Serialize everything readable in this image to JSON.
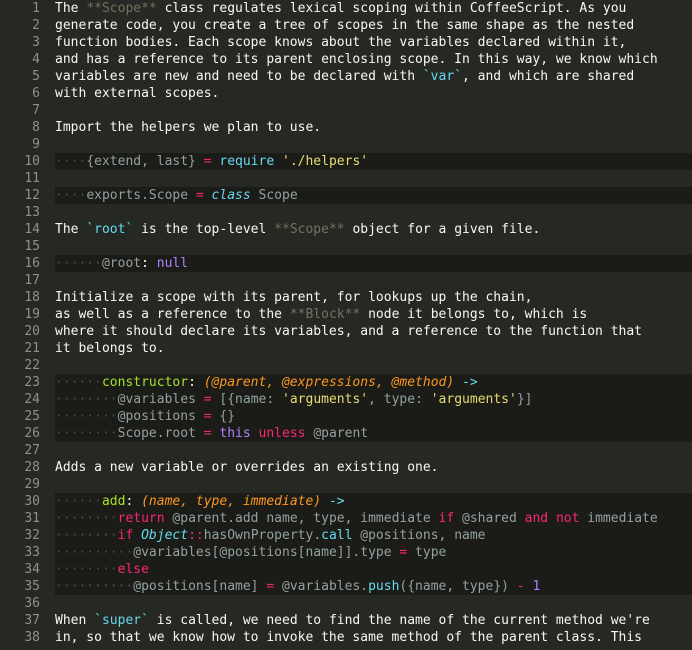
{
  "editor": {
    "lines": [
      {
        "n": "1",
        "code": false,
        "segs": [
          [
            "The ",
            "t-plain"
          ],
          [
            "**Scope**",
            "t-c"
          ],
          [
            " class regulates lexical scoping within CoffeeScript. As you",
            "t-plain"
          ]
        ]
      },
      {
        "n": "2",
        "code": false,
        "segs": [
          [
            "generate code, you create a tree of scopes in the same shape as the nested",
            "t-plain"
          ]
        ]
      },
      {
        "n": "3",
        "code": false,
        "segs": [
          [
            "function bodies. Each scope knows about the variables declared within it,",
            "t-plain"
          ]
        ]
      },
      {
        "n": "4",
        "code": false,
        "segs": [
          [
            "and has a reference to its parent enclosing scope. In this way, we know which",
            "t-plain"
          ]
        ]
      },
      {
        "n": "5",
        "code": false,
        "segs": [
          [
            "variables are new and need to be declared with ",
            "t-plain"
          ],
          [
            "`var`",
            "t-code"
          ],
          [
            ", and which are shared",
            "t-plain"
          ]
        ]
      },
      {
        "n": "6",
        "code": false,
        "segs": [
          [
            "with external scopes.",
            "t-plain"
          ]
        ]
      },
      {
        "n": "7",
        "code": false,
        "segs": []
      },
      {
        "n": "8",
        "code": false,
        "segs": [
          [
            "Import the helpers we plan to use.",
            "t-plain"
          ]
        ]
      },
      {
        "n": "9",
        "code": false,
        "segs": []
      },
      {
        "n": "10",
        "code": true,
        "segs": [
          [
            "····",
            "ws"
          ],
          [
            "{extend, last}",
            "t-ivar"
          ],
          [
            " = ",
            "t-kw"
          ],
          [
            "require",
            "t-prop"
          ],
          [
            " ",
            "t-plain"
          ],
          [
            "'./helpers'",
            "t-str"
          ]
        ]
      },
      {
        "n": "11",
        "code": false,
        "segs": []
      },
      {
        "n": "12",
        "code": true,
        "segs": [
          [
            "····",
            "ws"
          ],
          [
            "exports.Scope",
            "t-ivar"
          ],
          [
            " = ",
            "t-kw"
          ],
          [
            "class",
            "t-it"
          ],
          [
            " Scope",
            "t-ivar"
          ]
        ]
      },
      {
        "n": "13",
        "code": false,
        "segs": []
      },
      {
        "n": "14",
        "code": false,
        "segs": [
          [
            "The ",
            "t-plain"
          ],
          [
            "`root`",
            "t-code"
          ],
          [
            " is the top-level ",
            "t-plain"
          ],
          [
            "**Scope**",
            "t-c"
          ],
          [
            " object for a given file.",
            "t-plain"
          ]
        ]
      },
      {
        "n": "15",
        "code": false,
        "segs": []
      },
      {
        "n": "16",
        "code": true,
        "segs": [
          [
            "······",
            "ws"
          ],
          [
            "@root",
            "t-ivar"
          ],
          [
            ": ",
            "t-plain"
          ],
          [
            "null",
            "t-num"
          ]
        ]
      },
      {
        "n": "17",
        "code": false,
        "segs": []
      },
      {
        "n": "18",
        "code": false,
        "segs": [
          [
            "Initialize a scope with its parent, for lookups up the chain,",
            "t-plain"
          ]
        ]
      },
      {
        "n": "19",
        "code": false,
        "segs": [
          [
            "as well as a reference to the ",
            "t-plain"
          ],
          [
            "**Block**",
            "t-c"
          ],
          [
            " node it belongs to, which is",
            "t-plain"
          ]
        ]
      },
      {
        "n": "20",
        "code": false,
        "segs": [
          [
            "where it should declare its variables, and a reference to the function that",
            "t-plain"
          ]
        ]
      },
      {
        "n": "21",
        "code": false,
        "segs": [
          [
            "it belongs to.",
            "t-plain"
          ]
        ]
      },
      {
        "n": "22",
        "code": false,
        "segs": []
      },
      {
        "n": "23",
        "code": true,
        "segs": [
          [
            "······",
            "ws"
          ],
          [
            "constructor",
            "t-fn"
          ],
          [
            ": ",
            "t-plain"
          ],
          [
            "(@parent, @expressions, @method)",
            "t-par"
          ],
          [
            " ->",
            "t-prop"
          ]
        ]
      },
      {
        "n": "24",
        "code": true,
        "segs": [
          [
            "········",
            "ws"
          ],
          [
            "@variables",
            "t-ivar"
          ],
          [
            " = ",
            "t-kw"
          ],
          [
            "[{name: ",
            "t-ivar"
          ],
          [
            "'arguments'",
            "t-str"
          ],
          [
            ", type: ",
            "t-ivar"
          ],
          [
            "'arguments'",
            "t-str"
          ],
          [
            "}]",
            "t-ivar"
          ]
        ]
      },
      {
        "n": "25",
        "code": true,
        "segs": [
          [
            "········",
            "ws"
          ],
          [
            "@positions",
            "t-ivar"
          ],
          [
            " = ",
            "t-kw"
          ],
          [
            "{}",
            "t-ivar"
          ]
        ]
      },
      {
        "n": "26",
        "code": true,
        "segs": [
          [
            "········",
            "ws"
          ],
          [
            "Scope.root",
            "t-ivar"
          ],
          [
            " = ",
            "t-kw"
          ],
          [
            "this",
            "t-num"
          ],
          [
            " unless ",
            "t-kw"
          ],
          [
            "@parent",
            "t-ivar"
          ]
        ]
      },
      {
        "n": "27",
        "code": false,
        "segs": []
      },
      {
        "n": "28",
        "code": false,
        "segs": [
          [
            "Adds a new variable or overrides an existing one.",
            "t-plain"
          ]
        ]
      },
      {
        "n": "29",
        "code": false,
        "segs": []
      },
      {
        "n": "30",
        "code": true,
        "segs": [
          [
            "······",
            "ws"
          ],
          [
            "add",
            "t-fn"
          ],
          [
            ": ",
            "t-plain"
          ],
          [
            "(name, type, immediate)",
            "t-par"
          ],
          [
            " ->",
            "t-prop"
          ]
        ]
      },
      {
        "n": "31",
        "code": true,
        "segs": [
          [
            "········",
            "ws"
          ],
          [
            "return",
            "t-kw"
          ],
          [
            " @parent.add name, type, immediate ",
            "t-ivar"
          ],
          [
            "if",
            "t-kw"
          ],
          [
            " @shared ",
            "t-ivar"
          ],
          [
            "and not",
            "t-kw"
          ],
          [
            " immediate",
            "t-ivar"
          ]
        ]
      },
      {
        "n": "32",
        "code": true,
        "segs": [
          [
            "········",
            "ws"
          ],
          [
            "if",
            "t-kw"
          ],
          [
            " ",
            "t-plain"
          ],
          [
            "Object",
            "t-it"
          ],
          [
            "::",
            "t-kw"
          ],
          [
            "hasOwnProperty",
            "t-ivar"
          ],
          [
            ".",
            "t-ivar"
          ],
          [
            "call",
            "t-prop"
          ],
          [
            " @positions, name",
            "t-ivar"
          ]
        ]
      },
      {
        "n": "33",
        "code": true,
        "segs": [
          [
            "··········",
            "ws"
          ],
          [
            "@variables[@positions[name]].type",
            "t-ivar"
          ],
          [
            " = ",
            "t-kw"
          ],
          [
            "type",
            "t-ivar"
          ]
        ]
      },
      {
        "n": "34",
        "code": true,
        "segs": [
          [
            "········",
            "ws"
          ],
          [
            "else",
            "t-kw"
          ]
        ]
      },
      {
        "n": "35",
        "code": true,
        "segs": [
          [
            "··········",
            "ws"
          ],
          [
            "@positions[name]",
            "t-ivar"
          ],
          [
            " = ",
            "t-kw"
          ],
          [
            "@variables.",
            "t-ivar"
          ],
          [
            "push",
            "t-prop"
          ],
          [
            "({name, type})",
            "t-ivar"
          ],
          [
            " - ",
            "t-kw"
          ],
          [
            "1",
            "t-num"
          ]
        ]
      },
      {
        "n": "36",
        "code": false,
        "segs": []
      },
      {
        "n": "37",
        "code": false,
        "segs": [
          [
            "When ",
            "t-plain"
          ],
          [
            "`super`",
            "t-code"
          ],
          [
            " is called, we need to find the name of the current method we're",
            "t-plain"
          ]
        ]
      },
      {
        "n": "38",
        "code": false,
        "segs": [
          [
            "in, so that we know how to invoke the same method of the parent class. This",
            "t-plain"
          ]
        ]
      }
    ]
  }
}
